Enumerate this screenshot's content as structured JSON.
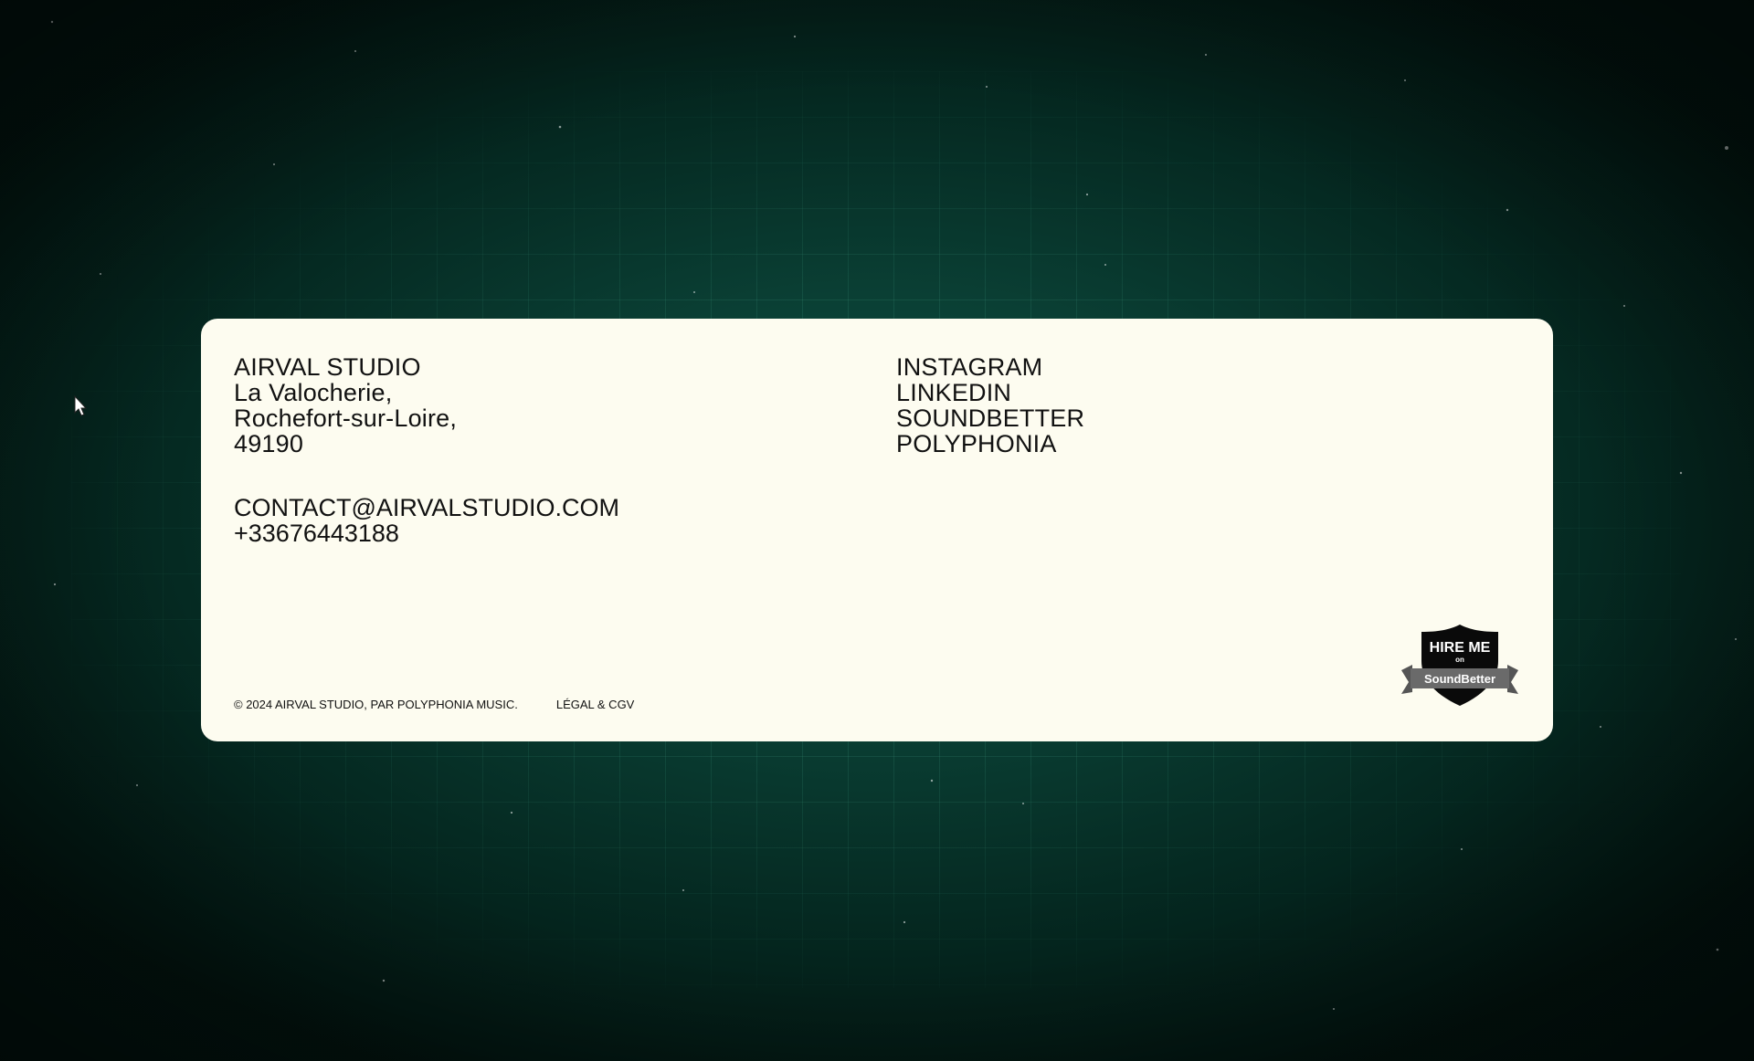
{
  "theme": {
    "card_bg": "#fdfcf0",
    "text": "#111111",
    "bg_dark": "#031c17",
    "bg_glow": "#0d5446"
  },
  "address": {
    "studio_name": "AIRVAL STUDIO",
    "lines": [
      "La Valocherie,",
      "Rochefort-sur-Loire,",
      "49190"
    ]
  },
  "contact": {
    "email": "CONTACT@AIRVALSTUDIO.COM",
    "phone": "+33676443188"
  },
  "social_links": [
    {
      "label": "INSTAGRAM"
    },
    {
      "label": "LINKEDIN"
    },
    {
      "label": "SOUNDBETTER"
    },
    {
      "label": "POLYPHONIA"
    }
  ],
  "footer": {
    "copyright": "© 2024 AIRVAL STUDIO, PAR POLYPHONIA MUSIC.",
    "legal_link": "LÉGAL & CGV"
  },
  "badge": {
    "line1": "HIRE ME",
    "line2": "on",
    "brand": "SoundBetter",
    "icon": "soundbetter-shield-icon"
  }
}
